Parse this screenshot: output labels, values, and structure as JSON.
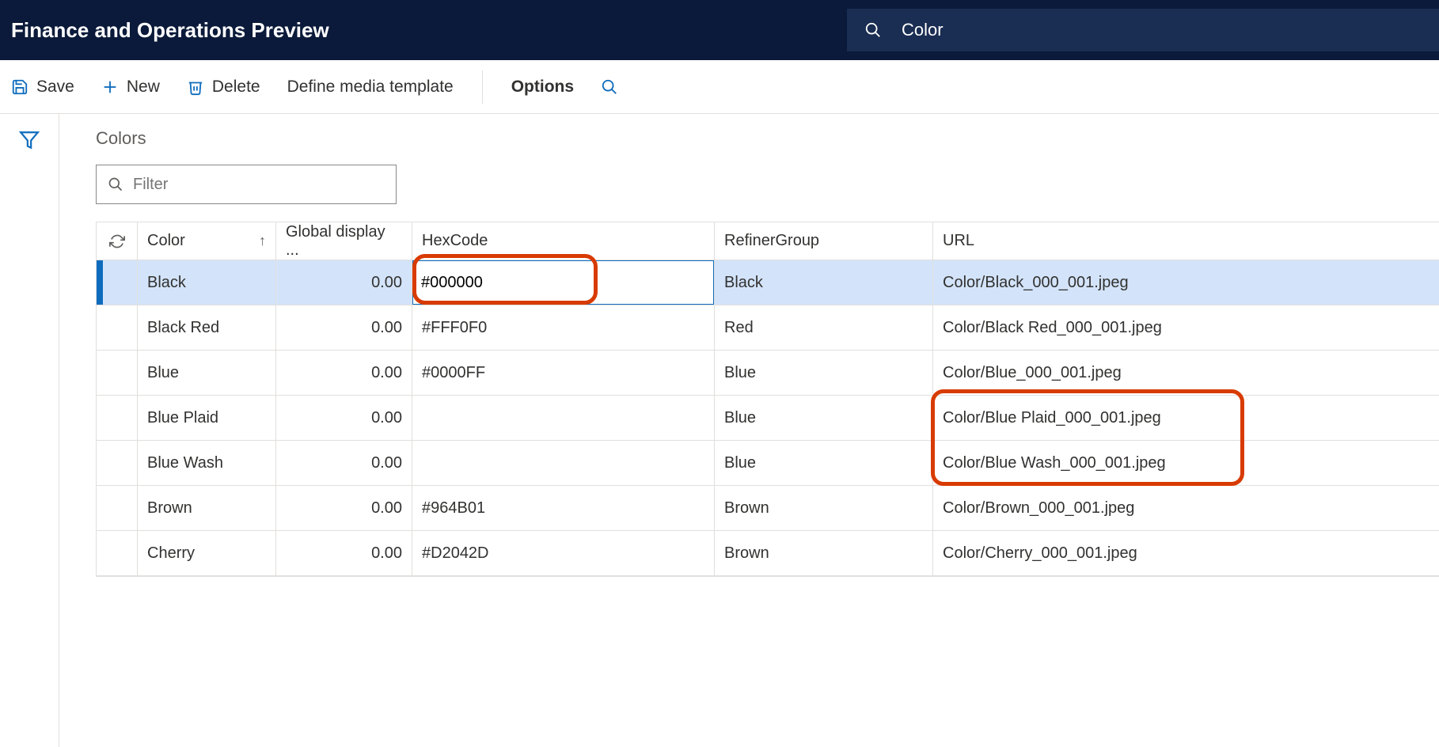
{
  "topbar": {
    "title": "Finance and Operations Preview",
    "search_text": "Color"
  },
  "toolbar": {
    "save": "Save",
    "new": "New",
    "delete": "Delete",
    "define_media_template": "Define media template",
    "options": "Options"
  },
  "section": {
    "title": "Colors"
  },
  "filter": {
    "placeholder": "Filter"
  },
  "columns": {
    "color": "Color",
    "gdo": "Global display ...",
    "hex": "HexCode",
    "refiner": "RefinerGroup",
    "url": "URL"
  },
  "rows": [
    {
      "color": "Black",
      "gdo": "0.00",
      "hex": "#000000",
      "refiner": "Black",
      "url": "Color/Black_000_001.jpeg",
      "selected": true
    },
    {
      "color": "Black Red",
      "gdo": "0.00",
      "hex": "#FFF0F0",
      "refiner": "Red",
      "url": "Color/Black Red_000_001.jpeg"
    },
    {
      "color": "Blue",
      "gdo": "0.00",
      "hex": "#0000FF",
      "refiner": "Blue",
      "url": "Color/Blue_000_001.jpeg"
    },
    {
      "color": "Blue Plaid",
      "gdo": "0.00",
      "hex": "",
      "refiner": "Blue",
      "url": "Color/Blue Plaid_000_001.jpeg"
    },
    {
      "color": "Blue Wash",
      "gdo": "0.00",
      "hex": "",
      "refiner": "Blue",
      "url": "Color/Blue Wash_000_001.jpeg"
    },
    {
      "color": "Brown",
      "gdo": "0.00",
      "hex": "#964B01",
      "refiner": "Brown",
      "url": "Color/Brown_000_001.jpeg"
    },
    {
      "color": "Cherry",
      "gdo": "0.00",
      "hex": "#D2042D",
      "refiner": "Brown",
      "url": "Color/Cherry_000_001.jpeg"
    }
  ]
}
